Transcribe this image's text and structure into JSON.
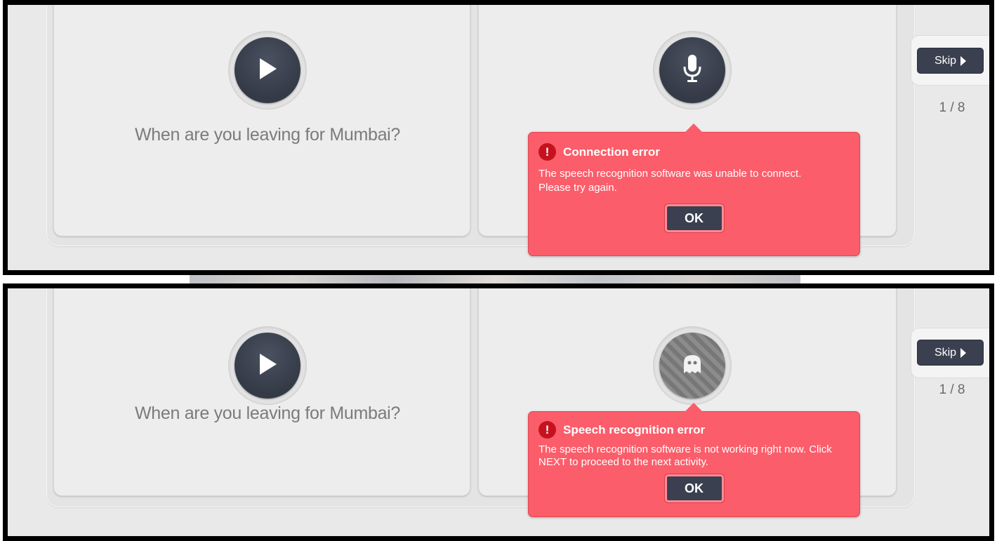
{
  "panels": [
    {
      "prompt": "When are you leaving for Mumbai?",
      "play_icon": "play-icon",
      "mic_icon": "microphone-icon",
      "mic_state": "active",
      "error": {
        "icon": "exclamation-icon",
        "mark": "!",
        "title": "Connection error",
        "message": "The speech recognition software was unable to connect. Please try again.",
        "ok_label": "OK"
      },
      "skip_label": "Skip",
      "progress": "1 / 8"
    },
    {
      "prompt": "When are you leaving for Mumbai?",
      "play_icon": "play-icon",
      "mic_icon": "ghost-icon",
      "mic_state": "disabled",
      "error": {
        "icon": "exclamation-icon",
        "mark": "!",
        "title": "Speech recognition error",
        "message": "The speech recognition software is not working right now. Click NEXT to proceed to the next activity.",
        "ok_label": "OK"
      },
      "skip_label": "Skip",
      "progress": "1 / 8"
    }
  ],
  "colors": {
    "error_bg": "#fb5d6a",
    "alert_icon": "#c4131f",
    "button_dark": "#3a4050",
    "panel_bg": "#e9e9e9"
  }
}
